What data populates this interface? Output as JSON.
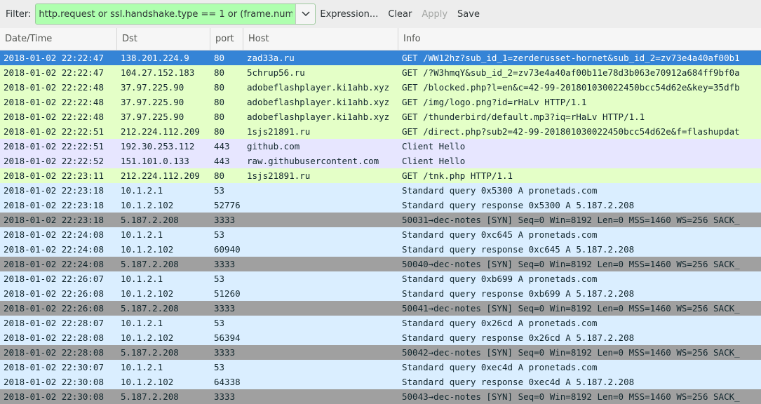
{
  "toolbar": {
    "filter_label": "Filter:",
    "filter_value": "http.request or ssl.handshake.type == 1 or (frame.num",
    "expression_label": "Expression...",
    "clear_label": "Clear",
    "apply_label": "Apply",
    "save_label": "Save"
  },
  "columns": [
    "Date/Time",
    "Dst",
    "port",
    "Host",
    "Info"
  ],
  "rows": [
    {
      "time": "2018-01-02 22:22:47",
      "dst": "138.201.224.9",
      "port": "80",
      "host": "zad33a.ru",
      "info": "GET /WW12hz?sub_id_1=zerderusset-hornet&sub_id_2=zv73e4a40af00b1"
    },
    {
      "time": "2018-01-02 22:22:47",
      "dst": "104.27.152.183",
      "port": "80",
      "host": "5chrup56.ru",
      "info": "GET /?W3hmqY&sub_id_2=zv73e4a40af00b11e78d3b063e70912a684ff9bf0a"
    },
    {
      "time": "2018-01-02 22:22:48",
      "dst": "37.97.225.90",
      "port": "80",
      "host": "adobeflashplayer.ki1ahb.xyz",
      "info": "GET /blocked.php?l=en&c=42-99-201801030022450bcc54d62e&key=35dfb"
    },
    {
      "time": "2018-01-02 22:22:48",
      "dst": "37.97.225.90",
      "port": "80",
      "host": "adobeflashplayer.ki1ahb.xyz",
      "info": "GET /img/logo.png?id=rHaLv HTTP/1.1"
    },
    {
      "time": "2018-01-02 22:22:48",
      "dst": "37.97.225.90",
      "port": "80",
      "host": "adobeflashplayer.ki1ahb.xyz",
      "info": "GET /thunderbird/default.mp3?iq=rHaLv HTTP/1.1"
    },
    {
      "time": "2018-01-02 22:22:51",
      "dst": "212.224.112.209",
      "port": "80",
      "host": "1sjs21891.ru",
      "info": "GET /direct.php?sub2=42-99-201801030022450bcc54d62e&f=flashupdat"
    },
    {
      "time": "2018-01-02 22:22:51",
      "dst": "192.30.253.112",
      "port": "443",
      "host": "github.com",
      "info": "Client Hello"
    },
    {
      "time": "2018-01-02 22:22:52",
      "dst": "151.101.0.133",
      "port": "443",
      "host": "raw.githubusercontent.com",
      "info": "Client Hello"
    },
    {
      "time": "2018-01-02 22:23:11",
      "dst": "212.224.112.209",
      "port": "80",
      "host": "1sjs21891.ru",
      "info": "GET /tnk.php HTTP/1.1"
    },
    {
      "time": "2018-01-02 22:23:18",
      "dst": "10.1.2.1",
      "port": "53",
      "host": "",
      "info": "Standard query 0x5300  A pronetads.com"
    },
    {
      "time": "2018-01-02 22:23:18",
      "dst": "10.1.2.102",
      "port": "52776",
      "host": "",
      "info": "Standard query response 0x5300  A 5.187.2.208"
    },
    {
      "time": "2018-01-02 22:23:18",
      "dst": "5.187.2.208",
      "port": "3333",
      "host": "",
      "info": "50031→dec-notes [SYN] Seq=0 Win=8192 Len=0 MSS=1460 WS=256 SACK_"
    },
    {
      "time": "2018-01-02 22:24:08",
      "dst": "10.1.2.1",
      "port": "53",
      "host": "",
      "info": "Standard query 0xc645  A pronetads.com"
    },
    {
      "time": "2018-01-02 22:24:08",
      "dst": "10.1.2.102",
      "port": "60940",
      "host": "",
      "info": "Standard query response 0xc645  A 5.187.2.208"
    },
    {
      "time": "2018-01-02 22:24:08",
      "dst": "5.187.2.208",
      "port": "3333",
      "host": "",
      "info": "50040→dec-notes [SYN] Seq=0 Win=8192 Len=0 MSS=1460 WS=256 SACK_"
    },
    {
      "time": "2018-01-02 22:26:07",
      "dst": "10.1.2.1",
      "port": "53",
      "host": "",
      "info": "Standard query 0xb699  A pronetads.com"
    },
    {
      "time": "2018-01-02 22:26:08",
      "dst": "10.1.2.102",
      "port": "51260",
      "host": "",
      "info": "Standard query response 0xb699  A 5.187.2.208"
    },
    {
      "time": "2018-01-02 22:26:08",
      "dst": "5.187.2.208",
      "port": "3333",
      "host": "",
      "info": "50041→dec-notes [SYN] Seq=0 Win=8192 Len=0 MSS=1460 WS=256 SACK_"
    },
    {
      "time": "2018-01-02 22:28:07",
      "dst": "10.1.2.1",
      "port": "53",
      "host": "",
      "info": "Standard query 0x26cd  A pronetads.com"
    },
    {
      "time": "2018-01-02 22:28:08",
      "dst": "10.1.2.102",
      "port": "56394",
      "host": "",
      "info": "Standard query response 0x26cd  A 5.187.2.208"
    },
    {
      "time": "2018-01-02 22:28:08",
      "dst": "5.187.2.208",
      "port": "3333",
      "host": "",
      "info": "50042→dec-notes [SYN] Seq=0 Win=8192 Len=0 MSS=1460 WS=256 SACK_"
    },
    {
      "time": "2018-01-02 22:30:07",
      "dst": "10.1.2.1",
      "port": "53",
      "host": "",
      "info": "Standard query 0xec4d  A pronetads.com"
    },
    {
      "time": "2018-01-02 22:30:08",
      "dst": "10.1.2.102",
      "port": "64338",
      "host": "",
      "info": "Standard query response 0xec4d  A 5.187.2.208"
    },
    {
      "time": "2018-01-02 22:30:08",
      "dst": "5.187.2.208",
      "port": "3333",
      "host": "",
      "info": "50043→dec-notes [SYN] Seq=0 Win=8192 Len=0 MSS=1460 WS=256 SACK_"
    }
  ]
}
